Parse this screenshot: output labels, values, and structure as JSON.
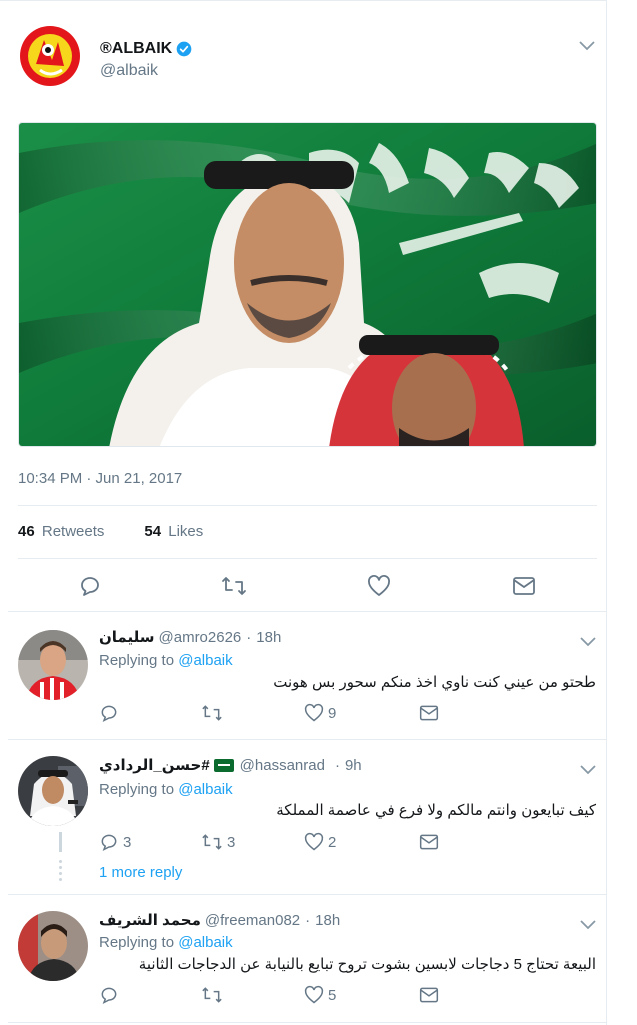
{
  "tweet": {
    "display_name": "®ALBAIK",
    "handle": "@albaik",
    "timestamp": "10:34 PM · Jun 21, 2017",
    "retweets_count": "46",
    "retweets_label": "Retweets",
    "likes_count": "54",
    "likes_label": "Likes",
    "image_alt": "flag-portrait-image",
    "colors": {
      "accent": "#1da1f2",
      "flag_green": "#0f7a3a",
      "muted": "#657786"
    }
  },
  "replies": [
    {
      "name": "سليمان",
      "handle": "@amro2626",
      "time": "18h",
      "replying_prefix": "Replying to",
      "replying_to": "@albaik",
      "text": "طحتو من عيني كنت ناوي اخذ منكم سحور بس هونت",
      "reply_count": "",
      "retweet_count": "",
      "like_count": "9"
    },
    {
      "name": "حسن_الردادي#",
      "handle": "@hassanrad",
      "time": "9h",
      "replying_prefix": "Replying to",
      "replying_to": "@albaik",
      "text": "كيف تبايعون وانتم مالكم ولا فرع في عاصمة المملكة",
      "reply_count": "3",
      "retweet_count": "3",
      "like_count": "2",
      "more_reply": "1 more reply"
    },
    {
      "name": "محمد الشريف",
      "handle": "@freeman082",
      "time": "18h",
      "replying_prefix": "Replying to",
      "replying_to": "@albaik",
      "text": "البيعة تحتاج 5 دجاجات لابسين بشوت تروح تبايع بالنيابة عن الدجاجات الثانية",
      "reply_count": "",
      "retweet_count": "",
      "like_count": "5"
    }
  ]
}
